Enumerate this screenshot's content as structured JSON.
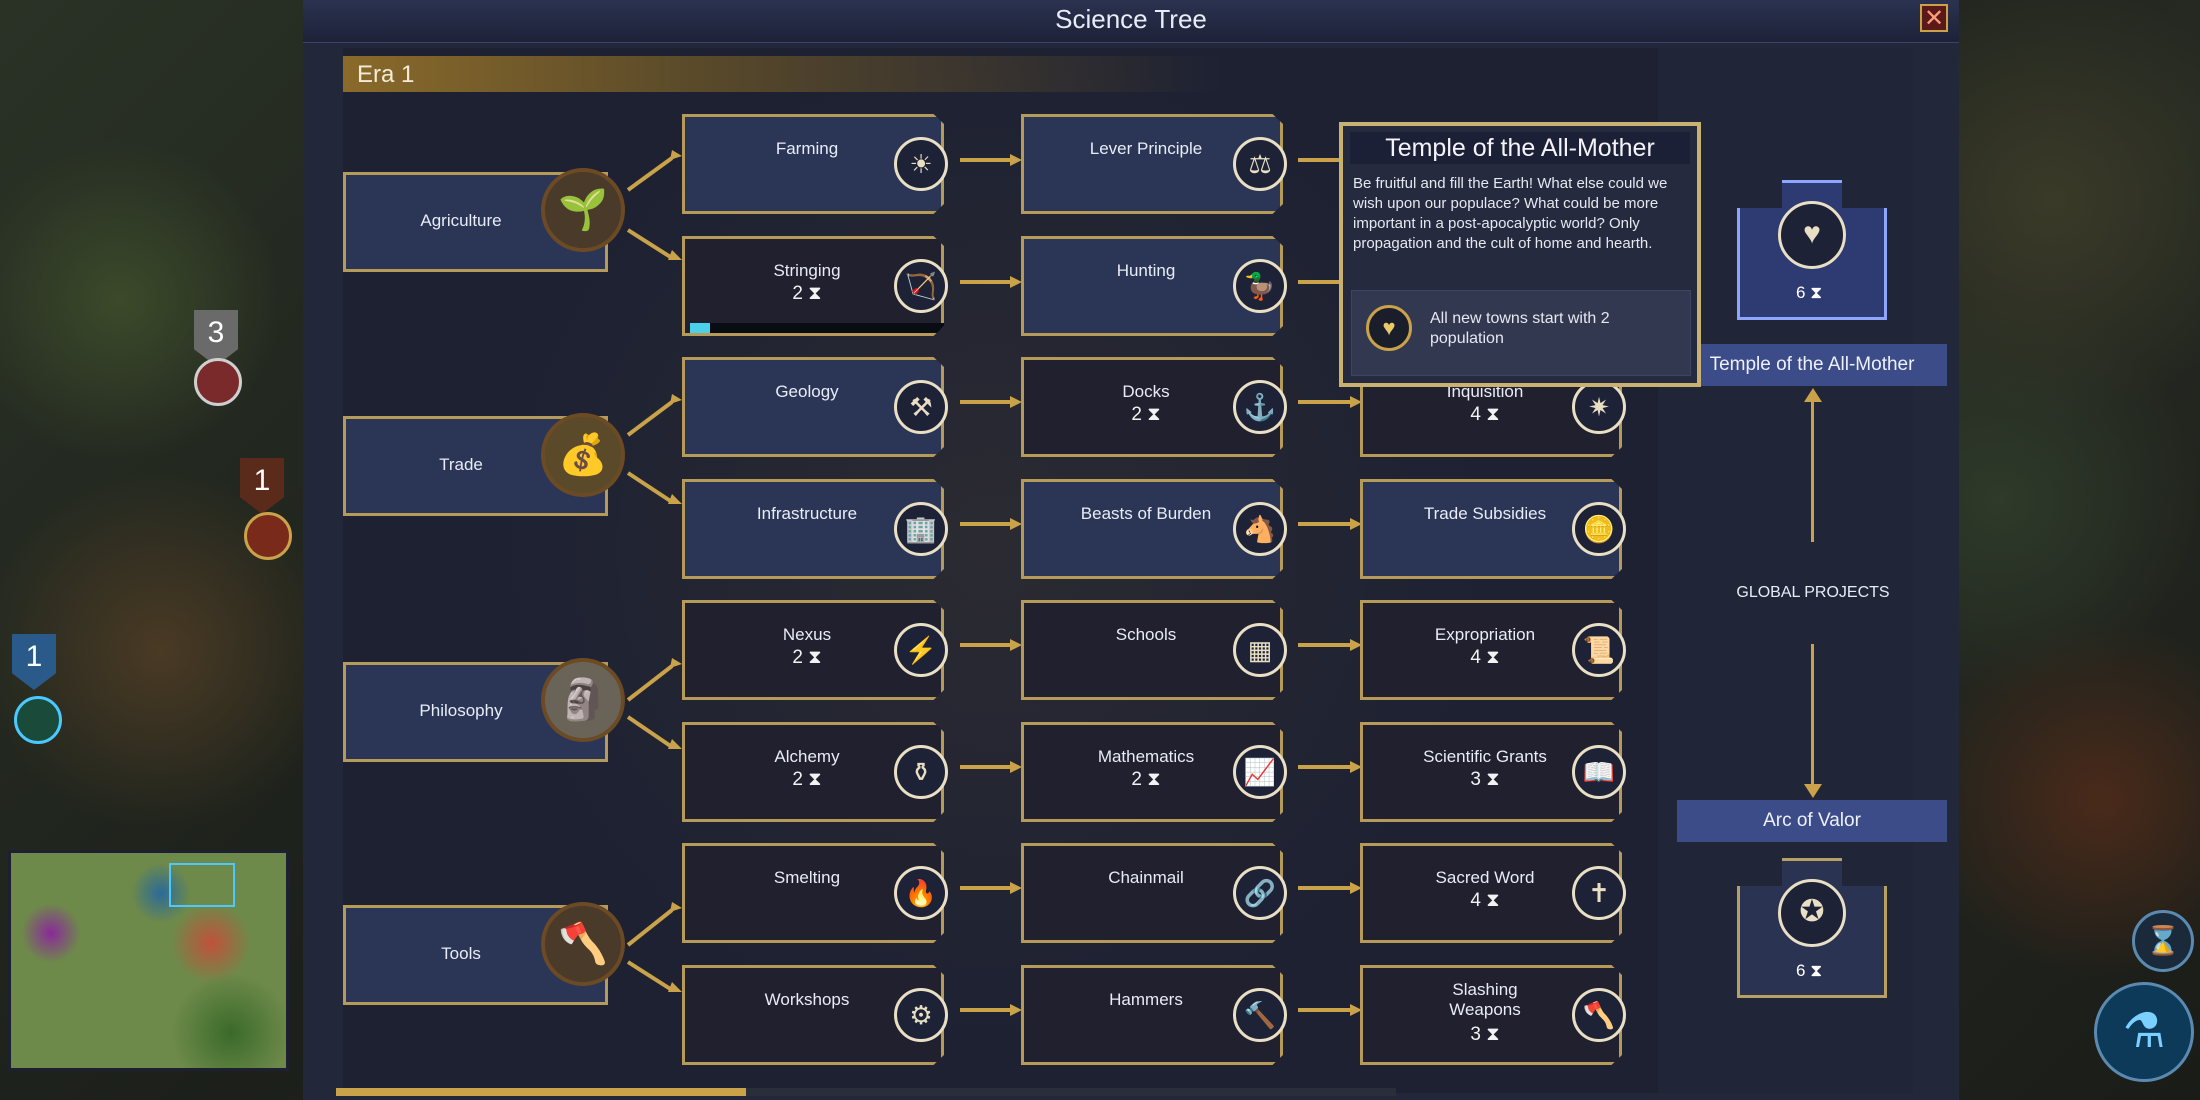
{
  "window": {
    "title": "Science Tree",
    "close_icon": "close-icon"
  },
  "era": {
    "label": "Era 1"
  },
  "categories": [
    {
      "name": "Agriculture",
      "icon": "sprout-in-hands-icon"
    },
    {
      "name": "Trade",
      "icon": "money-bag-icon"
    },
    {
      "name": "Philosophy",
      "icon": "bust-icon"
    },
    {
      "name": "Tools",
      "icon": "axe-saw-icon"
    }
  ],
  "techs": {
    "farming": {
      "name": "Farming",
      "turns": "",
      "icon": "field-sun-icon"
    },
    "stringing": {
      "name": "Stringing",
      "turns": "2",
      "icon": "bow-icon",
      "progress": 0.08
    },
    "geology": {
      "name": "Geology",
      "turns": "",
      "icon": "pick-shovel-icon"
    },
    "infrastructure": {
      "name": "Infrastructure",
      "turns": "",
      "icon": "buildings-icon"
    },
    "nexus": {
      "name": "Nexus",
      "turns": "2",
      "icon": "lightning-icon"
    },
    "alchemy": {
      "name": "Alchemy",
      "turns": "2",
      "icon": "mortar-icon"
    },
    "smelting": {
      "name": "Smelting",
      "turns": "",
      "icon": "crucible-icon"
    },
    "workshops": {
      "name": "Workshops",
      "turns": "",
      "icon": "anvil-icon"
    },
    "lever_principle": {
      "name": "Lever Principle",
      "turns": "",
      "icon": "lever-icon"
    },
    "hunting": {
      "name": "Hunting",
      "turns": "",
      "icon": "duck-icon"
    },
    "docks": {
      "name": "Docks",
      "turns": "2",
      "icon": "pier-icon"
    },
    "beasts_of_burden": {
      "name": "Beasts of Burden",
      "turns": "",
      "icon": "horse-head-icon"
    },
    "schools": {
      "name": "Schools",
      "turns": "",
      "icon": "blackboard-icon"
    },
    "mathematics": {
      "name": "Mathematics",
      "turns": "2",
      "icon": "graph-icon"
    },
    "chainmail": {
      "name": "Chainmail",
      "turns": "",
      "icon": "chain-link-icon"
    },
    "hammers": {
      "name": "Hammers",
      "turns": "",
      "icon": "hammer-icon"
    },
    "inquisition": {
      "name": "Inquisition",
      "turns": "4",
      "icon": "eye-sun-icon"
    },
    "trade_subsidies": {
      "name": "Trade Subsidies",
      "turns": "",
      "icon": "coins-up-icon"
    },
    "expropriation": {
      "name": "Expropriation",
      "turns": "4",
      "icon": "scroll-icon"
    },
    "scientific_grants": {
      "name": "Scientific Grants",
      "turns": "3",
      "icon": "open-book-icon"
    },
    "sacred_word": {
      "name": "Sacred Word",
      "turns": "4",
      "icon": "holy-book-icon"
    },
    "slashing_weapons": {
      "name": "Slashing\nWeapons",
      "turns": "3",
      "icon": "axe-icon"
    }
  },
  "tooltip": {
    "title": "Temple of the All-Mother",
    "description": "Be fruitful and fill the Earth! What else could we wish upon our populace? What could be more important in a post-apocalyptic world? Only propagation and the cult of home and hearth.",
    "effect_icon": "heart-hands-icon",
    "effect": "All new towns start with 2 population"
  },
  "projects": {
    "section_label": "GLOBAL PROJECTS",
    "temple": {
      "name": "Temple of the All-Mother",
      "turns": "6",
      "icon": "heart-hands-icon"
    },
    "arc": {
      "name": "Arc of Valor",
      "turns": "6",
      "icon": "medal-icon"
    }
  },
  "map": {
    "unit_counts": [
      "3",
      "1",
      "1"
    ]
  },
  "colors": {
    "accent_gold": "#c9a24a",
    "node_blue": "#2b3656",
    "node_dark": "#20202e",
    "progress_cyan": "#4ad0e8",
    "project_label": "#3c4c88"
  }
}
